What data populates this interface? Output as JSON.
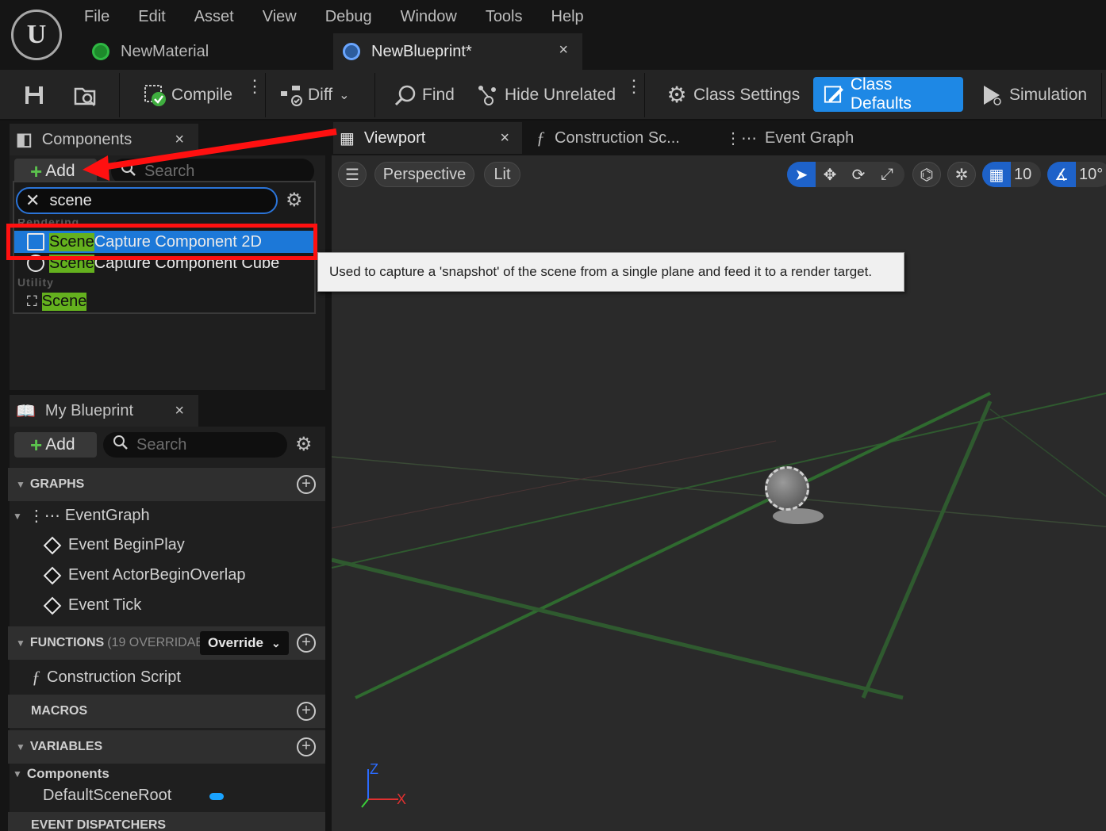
{
  "menu": [
    "File",
    "Edit",
    "Asset",
    "View",
    "Debug",
    "Window",
    "Tools",
    "Help"
  ],
  "doc_tabs": {
    "material": "NewMaterial",
    "blueprint": "NewBlueprint*",
    "close": "×"
  },
  "toolbar": {
    "compile": "Compile",
    "diff": "Diff",
    "find": "Find",
    "hide_unrelated": "Hide Unrelated",
    "class_settings": "Class Settings",
    "class_defaults": "Class Defaults",
    "simulation": "Simulation"
  },
  "components_panel": {
    "title": "Components",
    "close": "×",
    "add_label": "Add",
    "search_placeholder": "Search",
    "filter_value": "scene",
    "category_rendering": "Rendering",
    "category_utility": "Utility",
    "results": [
      {
        "match": "Scene",
        "rest": " Capture Component 2D",
        "selected": true
      },
      {
        "match": "Scene",
        "rest": " Capture Component Cube",
        "selected": false
      },
      {
        "match": "Scene",
        "rest": "",
        "selected": false
      }
    ]
  },
  "tooltip": "Used to capture a 'snapshot' of the scene from a single plane and feed it to a render target.",
  "my_blueprint": {
    "title": "My Blueprint",
    "close": "×",
    "add_label": "Add",
    "search_placeholder": "Search",
    "graphs": "GRAPHS",
    "event_graph": "EventGraph",
    "events": [
      "Event BeginPlay",
      "Event ActorBeginOverlap",
      "Event Tick"
    ],
    "functions": "FUNCTIONS",
    "functions_count": "(19 OVERRIDABL",
    "override": "Override",
    "construction_script": "Construction Script",
    "macros": "MACROS",
    "variables": "VARIABLES",
    "components_cat": "Components",
    "default_scene_root": "DefaultSceneRoot",
    "event_dispatchers": "EVENT DISPATCHERS"
  },
  "viewport_tabs": {
    "viewport": "Viewport",
    "construction": "Construction Sc...",
    "event_graph": "Event Graph",
    "close": "×"
  },
  "viewport": {
    "perspective": "Perspective",
    "lit": "Lit",
    "grid_size": "10",
    "angle": "10°",
    "axis_x": "X",
    "axis_z": "Z"
  },
  "colors": {
    "accent_blue": "#1e88e5",
    "highlight_green": "#64b11e",
    "annotation_red": "#ff1010"
  }
}
